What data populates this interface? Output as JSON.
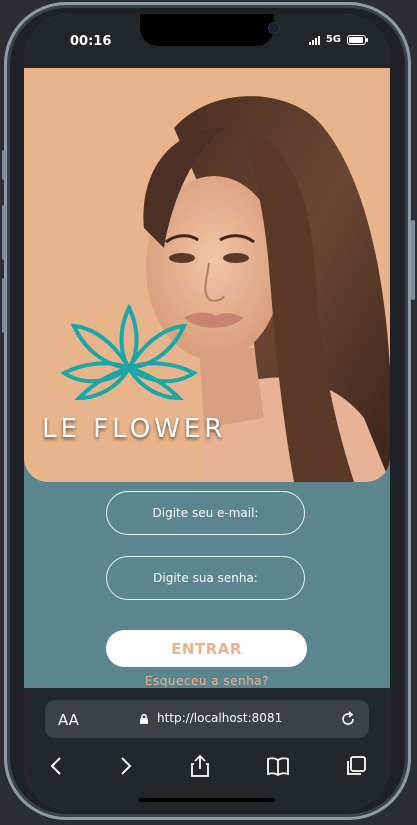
{
  "status_bar": {
    "time": "00:16",
    "network": "5G"
  },
  "hero": {
    "brand_name": "LE FLOWER"
  },
  "form": {
    "email_placeholder": "Digite seu e-mail:",
    "password_placeholder": "Digite sua senha:",
    "login_label": "ENTRAR",
    "forgot_label": "Esqueceu a senha?"
  },
  "browser": {
    "text_size_label": "AA",
    "url": "http://localhost:8081",
    "icons": [
      "lock-icon",
      "reload-icon",
      "back-icon",
      "forward-icon",
      "share-icon",
      "bookmarks-icon",
      "tabs-icon"
    ]
  },
  "colors": {
    "hero_bg": "#e8b48b",
    "form_bg": "#5b8690",
    "accent": "#e8b38b",
    "logo_teal": "#1ba7a8"
  }
}
